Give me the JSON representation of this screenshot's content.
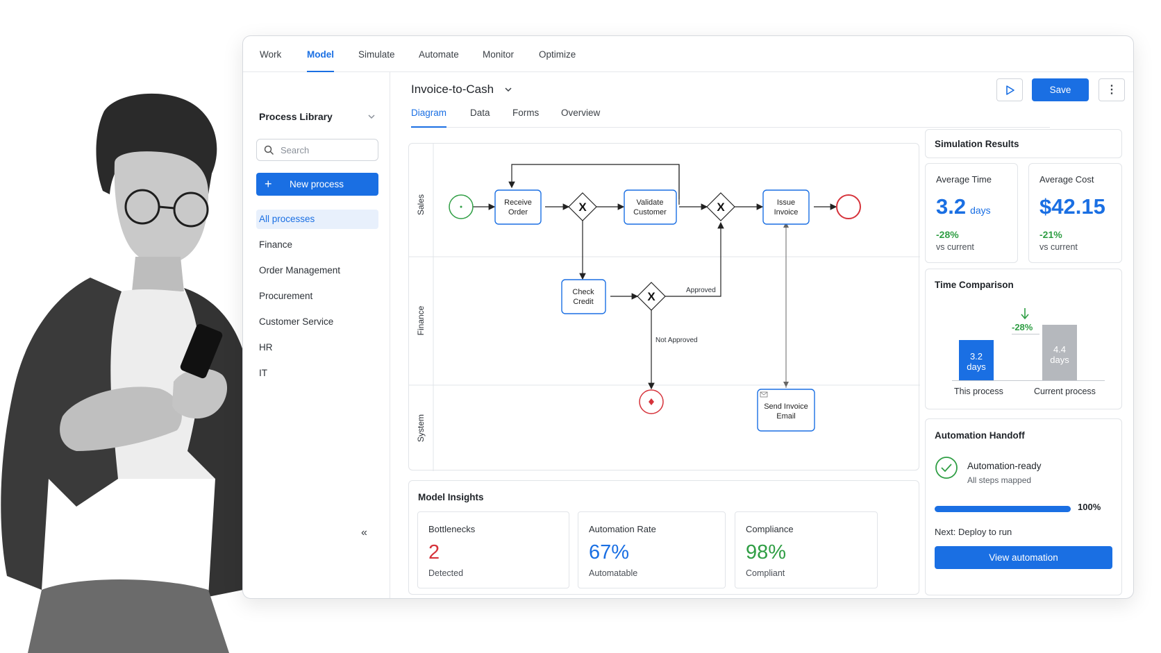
{
  "nav": {
    "tabs": [
      "Work",
      "Model",
      "Simulate",
      "Automate",
      "Monitor",
      "Optimize"
    ],
    "active": "Model"
  },
  "sidebar": {
    "title": "Process Library",
    "search_placeholder": "Search",
    "new_label": "New process",
    "items": [
      "All processes",
      "Finance",
      "Order Management",
      "Procurement",
      "Customer Service",
      "HR",
      "IT"
    ],
    "active": "All processes",
    "collapse_glyph": "«"
  },
  "process": {
    "title": "Invoice-to-Cash",
    "save_label": "Save",
    "more_glyph": "⋮",
    "subtabs": [
      "Diagram",
      "Data",
      "Forms",
      "Overview"
    ],
    "active_subtab": "Diagram"
  },
  "diagram": {
    "lanes": [
      "Sales",
      "Finance",
      "System"
    ],
    "tasks": {
      "receive_order": [
        "Receive",
        "Order"
      ],
      "validate_customer": [
        "Validate",
        "Customer"
      ],
      "issue_invoice": [
        "Issue",
        "Invoice"
      ],
      "check_credit": [
        "Check",
        "Credit"
      ],
      "send_invoice_email": [
        "Send Invoice",
        "Email"
      ]
    },
    "gateway_glyph": "X",
    "labels": {
      "approved": "Approved",
      "not_approved": "Not Approved"
    }
  },
  "insights": {
    "title": "Model Insights",
    "cards": [
      {
        "title": "Bottlenecks",
        "value": "2",
        "sub": "Detected",
        "color": "#d6333b"
      },
      {
        "title": "Automation Rate",
        "value": "67%",
        "sub": "Automatable",
        "color": "#1a6fe3"
      },
      {
        "title": "Compliance",
        "value": "98%",
        "sub": "Compliant",
        "color": "#2f9e44"
      }
    ]
  },
  "simulation": {
    "title": "Simulation Results",
    "metrics": [
      {
        "title": "Average Time",
        "value": "3.2",
        "unit": "days",
        "delta": "-28%",
        "sub": "vs current"
      },
      {
        "title": "Average Cost",
        "value": "$42.15",
        "unit": "",
        "delta": "-21%",
        "sub": "vs current"
      }
    ]
  },
  "time_comparison": {
    "title": "Time Comparison",
    "delta": "-28%",
    "bars": [
      {
        "name": "This process",
        "value_label": "3.2",
        "unit": "days",
        "color": "#1a6fe3"
      },
      {
        "name": "Current process",
        "value_label": "4.4",
        "unit": "days",
        "color": "#b5b8bd"
      }
    ],
    "chart_data": {
      "type": "bar",
      "categories": [
        "This process",
        "Current process"
      ],
      "values": [
        3.2,
        4.4
      ]
    }
  },
  "handoff": {
    "title": "Automation Handoff",
    "status": "Automation-ready",
    "status_sub": "All steps mapped",
    "progress": 1.0,
    "progress_label": "100%",
    "next": "Next: Deploy to run",
    "button": "View automation"
  },
  "colors": {
    "accent": "#1a6fe3",
    "success": "#2f9e44",
    "danger": "#d6333b"
  }
}
